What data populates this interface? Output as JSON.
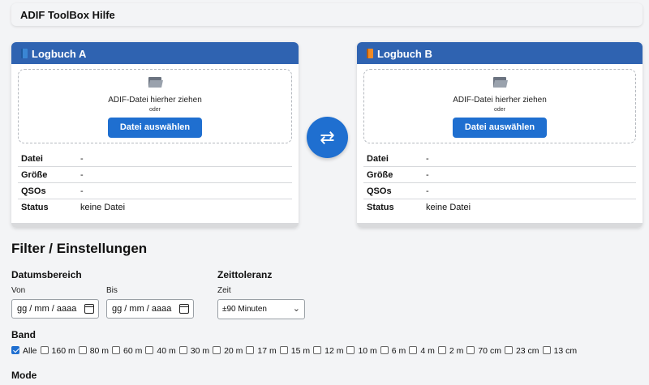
{
  "app": {
    "title": "ADIF ToolBox Hilfe"
  },
  "logbooks": [
    {
      "title": "Logbuch A",
      "book_color": "blue",
      "drop_hint": "ADIF-Datei hierher ziehen",
      "or_text": "oder",
      "button_label": "Datei auswählen",
      "info": [
        {
          "key": "Datei",
          "value": "-"
        },
        {
          "key": "Größe",
          "value": "-"
        },
        {
          "key": "QSOs",
          "value": "-"
        },
        {
          "key": "Status",
          "value": "keine Datei"
        }
      ]
    },
    {
      "title": "Logbuch B",
      "book_color": "orange",
      "drop_hint": "ADIF-Datei hierher ziehen",
      "or_text": "oder",
      "button_label": "Datei auswählen",
      "info": [
        {
          "key": "Datei",
          "value": "-"
        },
        {
          "key": "Größe",
          "value": "-"
        },
        {
          "key": "QSOs",
          "value": "-"
        },
        {
          "key": "Status",
          "value": "keine Datei"
        }
      ]
    }
  ],
  "swap_icon": "⇄",
  "filters": {
    "title": "Filter / Einstellungen",
    "date_range": {
      "label": "Datumsbereich",
      "from_label": "Von",
      "to_label": "Bis",
      "from_placeholder": "gg / mm / aaaa",
      "to_placeholder": "gg / mm / aaaa"
    },
    "time_tolerance": {
      "label": "Zeittoleranz",
      "sub_label": "Zeit",
      "selected": "±90 Minuten"
    },
    "band": {
      "label": "Band",
      "options": [
        {
          "label": "Alle",
          "checked": true
        },
        {
          "label": "160 m",
          "checked": false
        },
        {
          "label": "80 m",
          "checked": false
        },
        {
          "label": "60 m",
          "checked": false
        },
        {
          "label": "40 m",
          "checked": false
        },
        {
          "label": "30 m",
          "checked": false
        },
        {
          "label": "20 m",
          "checked": false
        },
        {
          "label": "17 m",
          "checked": false
        },
        {
          "label": "15 m",
          "checked": false
        },
        {
          "label": "12 m",
          "checked": false
        },
        {
          "label": "10 m",
          "checked": false
        },
        {
          "label": "6 m",
          "checked": false
        },
        {
          "label": "4 m",
          "checked": false
        },
        {
          "label": "2 m",
          "checked": false
        },
        {
          "label": "70 cm",
          "checked": false
        },
        {
          "label": "23 cm",
          "checked": false
        },
        {
          "label": "13 cm",
          "checked": false
        }
      ]
    },
    "mode": {
      "label": "Mode"
    }
  },
  "colors": {
    "accent": "#1f6fd0",
    "header": "#2f63b1"
  }
}
